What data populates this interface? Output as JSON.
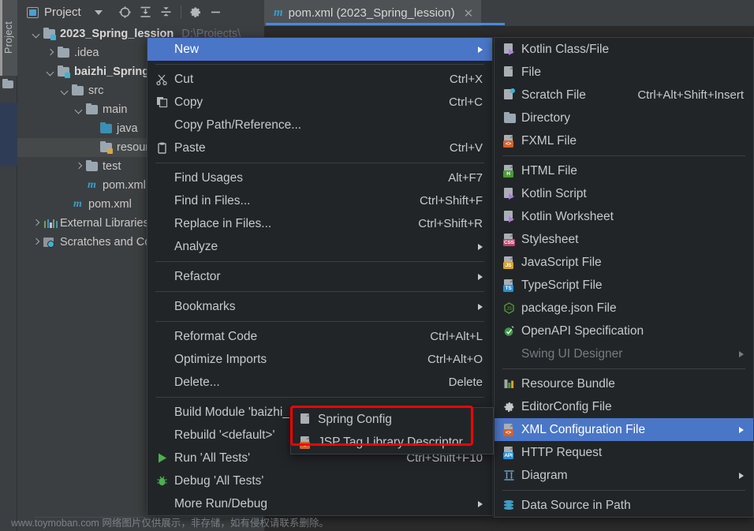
{
  "tool_strip": {
    "label": "Project",
    "icon": "folder-icon"
  },
  "panel_toolbar": {
    "title": "Project",
    "dropdown_icon": "chevron-down-icon",
    "buttons": [
      {
        "name": "locate-icon",
        "tooltip": "Select Opened File"
      },
      {
        "name": "expand-all-icon",
        "tooltip": "Expand All"
      },
      {
        "name": "collapse-all-icon",
        "tooltip": "Collapse All"
      },
      {
        "name": "settings-gear-icon",
        "tooltip": "Settings"
      },
      {
        "name": "minimize-icon",
        "tooltip": "Hide"
      }
    ]
  },
  "editor_tab": {
    "icon": "maven-m-icon",
    "title": "pom.xml (2023_Spring_lession)",
    "close_icon": "close-icon"
  },
  "project_tree": [
    {
      "label": "2023_Spring_lession",
      "suffix": "D:\\Projects\\",
      "indent": 0,
      "expand": "down",
      "icon": "module-folder-icon",
      "bold": true,
      "selected": false
    },
    {
      "label": ".idea",
      "indent": 1,
      "expand": "right",
      "icon": "folder-icon",
      "bold": false,
      "selected": false
    },
    {
      "label": "baizhi_Spring",
      "indent": 1,
      "expand": "down",
      "icon": "module-folder-icon",
      "bold": true,
      "selected": false
    },
    {
      "label": "src",
      "indent": 2,
      "expand": "down",
      "icon": "folder-icon",
      "bold": false,
      "selected": false
    },
    {
      "label": "main",
      "indent": 3,
      "expand": "down",
      "icon": "folder-icon",
      "bold": false,
      "selected": false
    },
    {
      "label": "java",
      "indent": 4,
      "expand": "none",
      "icon": "source-folder-icon",
      "bold": false,
      "selected": false
    },
    {
      "label": "resources",
      "indent": 4,
      "expand": "none",
      "icon": "resources-folder-icon",
      "bold": false,
      "selected": true
    },
    {
      "label": "test",
      "indent": 3,
      "expand": "right",
      "icon": "folder-icon",
      "bold": false,
      "selected": false
    },
    {
      "label": "pom.xml",
      "indent": 3,
      "expand": "none",
      "icon": "maven-m-icon",
      "bold": false,
      "selected": false
    },
    {
      "label": "pom.xml",
      "indent": 2,
      "expand": "none",
      "icon": "maven-m-icon",
      "bold": false,
      "selected": false
    },
    {
      "label": "External Libraries",
      "indent": 0,
      "expand": "right",
      "icon": "libraries-icon",
      "bold": false,
      "selected": false
    },
    {
      "label": "Scratches and Consoles",
      "indent": 0,
      "expand": "right",
      "icon": "scratches-icon",
      "bold": false,
      "selected": false
    }
  ],
  "context_menu": [
    {
      "label": "New",
      "icon": "",
      "accel": "",
      "submenu": true,
      "highlighted": true,
      "mnemonic": ""
    },
    {
      "separator": true
    },
    {
      "label": "Cut",
      "icon": "scissors-icon",
      "accel": "Ctrl+X",
      "submenu": false,
      "mnemonic": "t"
    },
    {
      "label": "Copy",
      "icon": "copy-icon",
      "accel": "Ctrl+C",
      "submenu": false,
      "mnemonic": "C"
    },
    {
      "label": "Copy Path/Reference...",
      "icon": "",
      "accel": "",
      "submenu": false,
      "mnemonic": ""
    },
    {
      "label": "Paste",
      "icon": "clipboard-icon",
      "accel": "Ctrl+V",
      "submenu": false,
      "mnemonic": "P"
    },
    {
      "separator": true
    },
    {
      "label": "Find Usages",
      "icon": "",
      "accel": "Alt+F7",
      "submenu": false,
      "mnemonic": "U"
    },
    {
      "label": "Find in Files...",
      "icon": "",
      "accel": "Ctrl+Shift+F",
      "submenu": false,
      "mnemonic": ""
    },
    {
      "label": "Replace in Files...",
      "icon": "",
      "accel": "Ctrl+Shift+R",
      "submenu": false,
      "mnemonic": "a"
    },
    {
      "label": "Analyze",
      "icon": "",
      "accel": "",
      "submenu": true,
      "mnemonic": "z"
    },
    {
      "separator": true
    },
    {
      "label": "Refactor",
      "icon": "",
      "accel": "",
      "submenu": true,
      "mnemonic": "R"
    },
    {
      "separator": true
    },
    {
      "label": "Bookmarks",
      "icon": "",
      "accel": "",
      "submenu": true,
      "mnemonic": ""
    },
    {
      "separator": true
    },
    {
      "label": "Reformat Code",
      "icon": "",
      "accel": "Ctrl+Alt+L",
      "submenu": false,
      "mnemonic": "R"
    },
    {
      "label": "Optimize Imports",
      "icon": "",
      "accel": "Ctrl+Alt+O",
      "submenu": false,
      "mnemonic": "z"
    },
    {
      "label": "Delete...",
      "icon": "",
      "accel": "Delete",
      "submenu": false,
      "mnemonic": "D"
    },
    {
      "separator": true
    },
    {
      "label": "Build Module 'baizhi_Spring'",
      "icon": "",
      "accel": "",
      "submenu": false,
      "mnemonic": "M"
    },
    {
      "label": "Rebuild '<default>'",
      "icon": "",
      "accel": "",
      "submenu": false,
      "mnemonic": "e"
    },
    {
      "label": "Run 'All Tests'",
      "icon": "run-icon",
      "accel": "Ctrl+Shift+F10",
      "submenu": false,
      "mnemonic": "u"
    },
    {
      "label": "Debug 'All Tests'",
      "icon": "debug-icon",
      "accel": "",
      "submenu": false,
      "mnemonic": "D"
    },
    {
      "label": "More Run/Debug",
      "icon": "",
      "accel": "",
      "submenu": true,
      "mnemonic": ""
    }
  ],
  "new_submenu": [
    {
      "label": "Kotlin Class/File",
      "icon": "kotlin-file-icon",
      "accel": "",
      "submenu": false
    },
    {
      "label": "File",
      "icon": "file-icon",
      "accel": "",
      "submenu": false
    },
    {
      "label": "Scratch File",
      "icon": "scratch-file-icon",
      "accel": "Ctrl+Alt+Shift+Insert",
      "submenu": false
    },
    {
      "label": "Directory",
      "icon": "directory-icon",
      "accel": "",
      "submenu": false
    },
    {
      "label": "FXML File",
      "icon": "fxml-file-icon",
      "accel": "",
      "submenu": false,
      "tag": "<>",
      "tagcolor": "#d4622b"
    },
    {
      "separator": true
    },
    {
      "label": "HTML File",
      "icon": "html-file-icon",
      "accel": "",
      "submenu": false,
      "tag": "H",
      "tagcolor": "#4a9a36"
    },
    {
      "label": "Kotlin Script",
      "icon": "kotlin-file-icon",
      "accel": "",
      "submenu": false
    },
    {
      "label": "Kotlin Worksheet",
      "icon": "kotlin-file-icon",
      "accel": "",
      "submenu": false
    },
    {
      "label": "Stylesheet",
      "icon": "css-file-icon",
      "accel": "",
      "submenu": false,
      "tag": "CSS",
      "tagcolor": "#b8456b"
    },
    {
      "label": "JavaScript File",
      "icon": "js-file-icon",
      "accel": "",
      "submenu": false,
      "tag": "JS",
      "tagcolor": "#d4a12b"
    },
    {
      "label": "TypeScript File",
      "icon": "ts-file-icon",
      "accel": "",
      "submenu": false,
      "tag": "TS",
      "tagcolor": "#2b8fd4"
    },
    {
      "label": "package.json File",
      "icon": "nodejs-icon",
      "accel": "",
      "submenu": false
    },
    {
      "label": "OpenAPI Specification",
      "icon": "openapi-icon",
      "accel": "",
      "submenu": false
    },
    {
      "label": "Swing UI Designer",
      "icon": "",
      "accel": "",
      "submenu": true,
      "disabled": true
    },
    {
      "separator": true
    },
    {
      "label": "Resource Bundle",
      "icon": "resource-bundle-icon",
      "accel": "",
      "submenu": false
    },
    {
      "label": "EditorConfig File",
      "icon": "editorconfig-icon",
      "accel": "",
      "submenu": false
    },
    {
      "label": "XML Configuration File",
      "icon": "xml-config-icon",
      "accel": "",
      "submenu": true,
      "highlighted": true,
      "tag": "<>",
      "tagcolor": "#d4622b"
    },
    {
      "label": "HTTP Request",
      "icon": "http-request-icon",
      "accel": "",
      "submenu": false,
      "tag": "API",
      "tagcolor": "#2b8fd4"
    },
    {
      "label": "Diagram",
      "icon": "diagram-icon",
      "accel": "",
      "submenu": true
    },
    {
      "separator": true
    },
    {
      "label": "Data Source in Path",
      "icon": "data-source-icon",
      "accel": "",
      "submenu": false
    }
  ],
  "spring_submenu": [
    {
      "label": "Spring Config",
      "icon": "spring-config-icon",
      "tag": "",
      "tagcolor": "#d4622b"
    },
    {
      "label": "JSP Tag Library Descriptor",
      "icon": "jsp-tld-icon",
      "tag": "<>",
      "tagcolor": "#d4622b"
    }
  ],
  "annotation": {
    "type": "red-rectangle-highlight",
    "color": "#ff0000",
    "target": "Spring Config"
  },
  "watermark": "www.toymoban.com 网络图片仅供展示，非存储，如有侵权请联系删除。",
  "colors": {
    "menu_bg": "#222528",
    "highlight_blue": "#4a76c8",
    "tab_underline": "#4a88e0",
    "panel_bg": "#3c3f41",
    "editor_bg": "#2b2b2b",
    "accent_red": "#ff0000"
  }
}
